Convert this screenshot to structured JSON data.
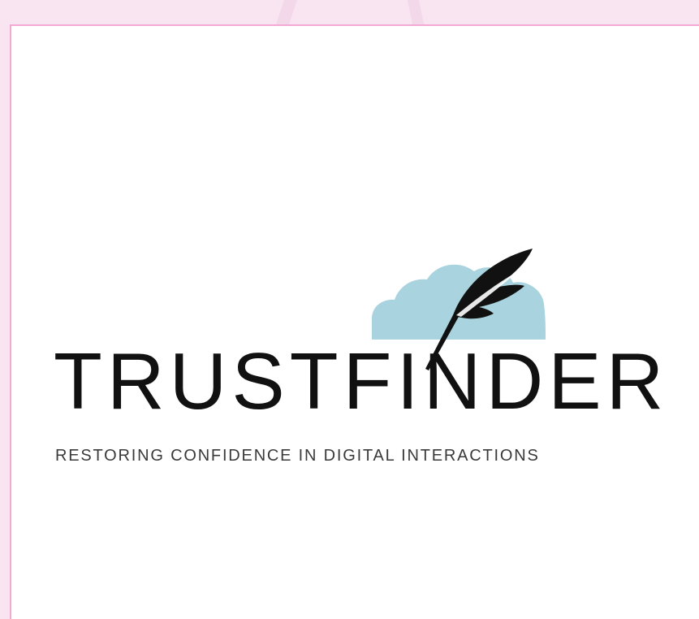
{
  "logo": {
    "brand_name": "TRUSTFINDER",
    "tagline": "RESTORING CONFIDENCE IN DIGITAL INTERACTIONS",
    "icons": [
      "cloud-icon",
      "quill-icon"
    ]
  },
  "colors": {
    "page_background": "#f9e4f1",
    "card_border": "#f4a8d4",
    "card_background": "#ffffff",
    "cloud": "#a9d3de",
    "text": "#111111"
  }
}
